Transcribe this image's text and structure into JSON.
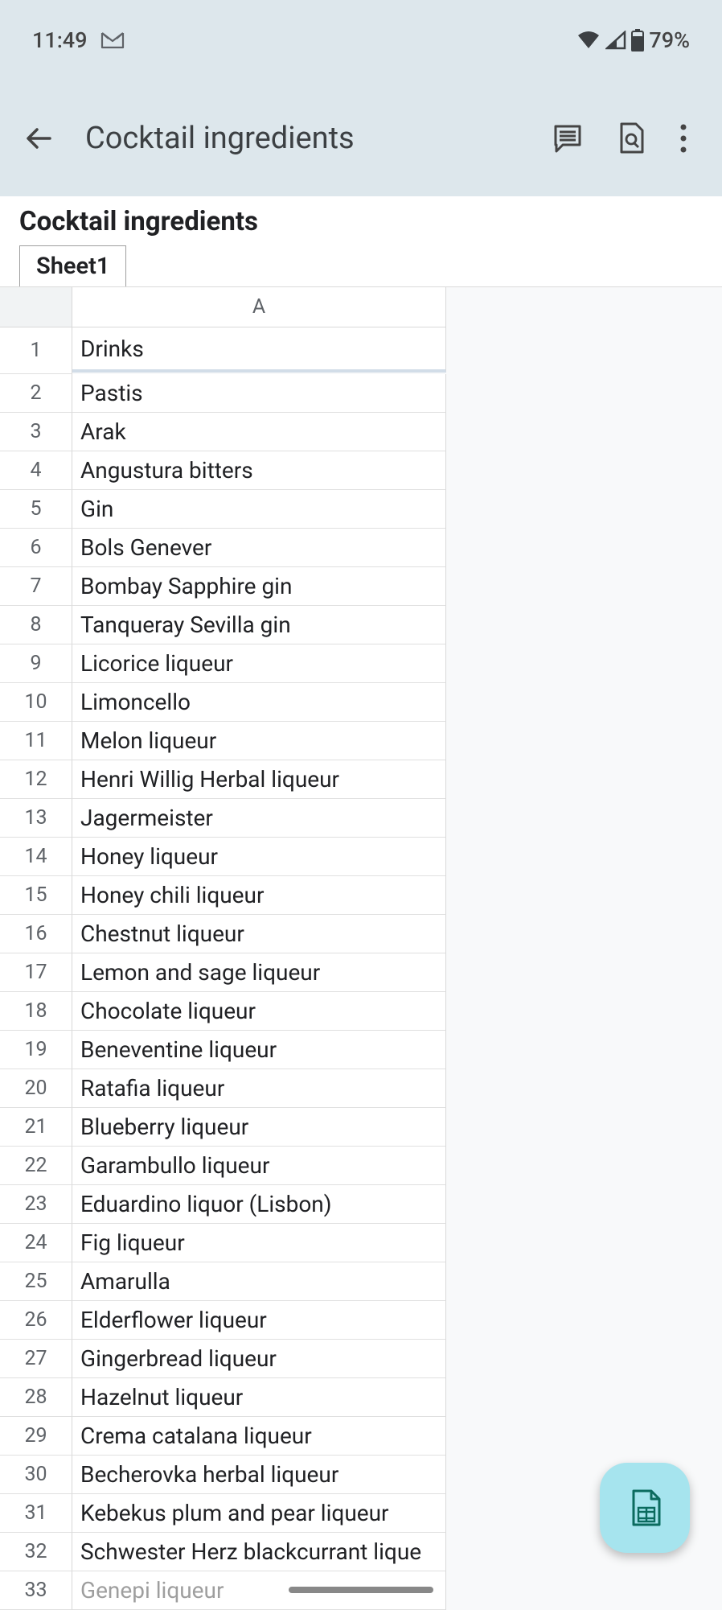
{
  "status_bar": {
    "time": "11:49",
    "battery": "79%"
  },
  "app_bar": {
    "title": "Cocktail ingredients"
  },
  "doc": {
    "title": "Cocktail ingredients",
    "active_tab": "Sheet1"
  },
  "sheet": {
    "col_header": "A",
    "rows": [
      {
        "n": "1",
        "value": "Drinks"
      },
      {
        "n": "2",
        "value": "Pastis"
      },
      {
        "n": "3",
        "value": "Arak"
      },
      {
        "n": "4",
        "value": "Angustura bitters"
      },
      {
        "n": "5",
        "value": "Gin"
      },
      {
        "n": "6",
        "value": "Bols Genever"
      },
      {
        "n": "7",
        "value": "Bombay Sapphire gin"
      },
      {
        "n": "8",
        "value": "Tanqueray Sevilla gin"
      },
      {
        "n": "9",
        "value": "Licorice liqueur"
      },
      {
        "n": "10",
        "value": "Limoncello"
      },
      {
        "n": "11",
        "value": "Melon liqueur"
      },
      {
        "n": "12",
        "value": "Henri Willig Herbal liqueur"
      },
      {
        "n": "13",
        "value": "Jagermeister"
      },
      {
        "n": "14",
        "value": "Honey liqueur"
      },
      {
        "n": "15",
        "value": "Honey chili liqueur"
      },
      {
        "n": "16",
        "value": "Chestnut liqueur"
      },
      {
        "n": "17",
        "value": "Lemon and sage liqueur"
      },
      {
        "n": "18",
        "value": "Chocolate liqueur"
      },
      {
        "n": "19",
        "value": "Beneventine liqueur"
      },
      {
        "n": "20",
        "value": "Ratafia liqueur"
      },
      {
        "n": "21",
        "value": "Blueberry liqueur"
      },
      {
        "n": "22",
        "value": "Garambullo liqueur"
      },
      {
        "n": "23",
        "value": "Eduardino liquor (Lisbon)"
      },
      {
        "n": "24",
        "value": "Fig liqueur"
      },
      {
        "n": "25",
        "value": "Amarulla"
      },
      {
        "n": "26",
        "value": "Elderflower liqueur"
      },
      {
        "n": "27",
        "value": "Gingerbread liqueur"
      },
      {
        "n": "28",
        "value": "Hazelnut liqueur"
      },
      {
        "n": "29",
        "value": "Crema catalana liqueur"
      },
      {
        "n": "30",
        "value": "Becherovka herbal liqueur"
      },
      {
        "n": "31",
        "value": "Kebekus plum and pear liqueur"
      },
      {
        "n": "32",
        "value": "Schwester Herz blackcurrant lique"
      },
      {
        "n": "33",
        "value": "Genepi liqueur"
      }
    ]
  }
}
